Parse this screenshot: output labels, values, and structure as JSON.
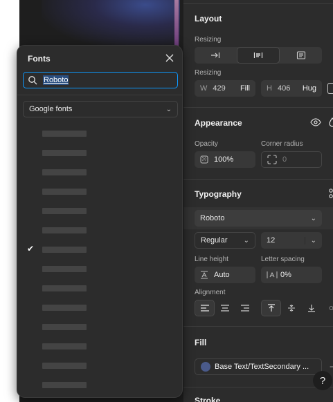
{
  "fonts_popover": {
    "title": "Fonts",
    "search_value": "Roboto",
    "source_select": "Google fonts",
    "rows": [
      {
        "checked": false
      },
      {
        "checked": false
      },
      {
        "checked": false
      },
      {
        "checked": false
      },
      {
        "checked": false
      },
      {
        "checked": false
      },
      {
        "checked": true
      },
      {
        "checked": false
      },
      {
        "checked": false
      },
      {
        "checked": false
      },
      {
        "checked": false
      },
      {
        "checked": false
      },
      {
        "checked": false
      },
      {
        "checked": false
      }
    ],
    "check_glyph": "✔"
  },
  "layout": {
    "title": "Layout",
    "resizing_label_1": "Resizing",
    "resizing_label_2": "Resizing",
    "width_prefix": "W",
    "width_value": "429",
    "width_mode": "Fill",
    "height_prefix": "H",
    "height_value": "406",
    "height_mode": "Hug"
  },
  "appearance": {
    "title": "Appearance",
    "opacity_label": "Opacity",
    "opacity_value": "100%",
    "corner_label": "Corner radius",
    "corner_value": "0"
  },
  "typography": {
    "title": "Typography",
    "font_family": "Roboto",
    "font_weight": "Regular",
    "font_size": "12",
    "line_height_label": "Line height",
    "line_height_value": "Auto",
    "letter_spacing_label": "Letter spacing",
    "letter_spacing_value": "0%",
    "alignment_label": "Alignment"
  },
  "fill": {
    "title": "Fill",
    "style_name": "Base Text/TextSecondary ..."
  },
  "stroke": {
    "title": "Stroke"
  },
  "help": {
    "label": "?"
  },
  "colors": {
    "panel_bg": "#2c2c2c",
    "focus_blue": "#0d99ff",
    "canvas_bg": "#1e1e1e"
  }
}
